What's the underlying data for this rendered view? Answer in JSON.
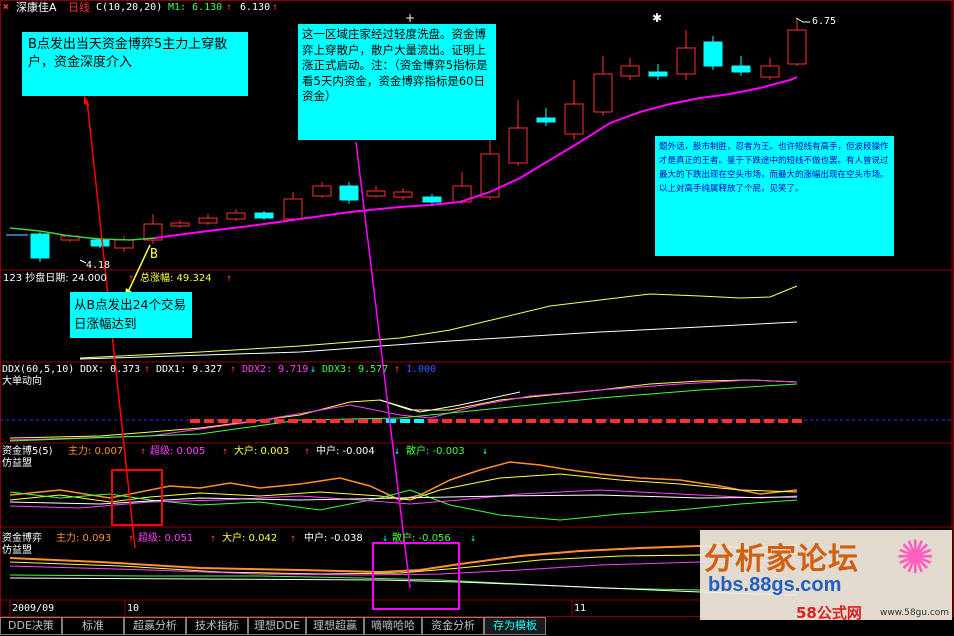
{
  "header": {
    "stock_name": "深康佳A",
    "period": "日线",
    "ma_label": "C(10,20,20)",
    "m1": "M1: 6.130",
    "m1_value": "6.130"
  },
  "price_panel": {
    "high_label": "6.75",
    "low_label": "4.18",
    "point_b": "B"
  },
  "notes": {
    "note1": "B点发出当天资金博弈5主力上穿散户，资金深度介入",
    "note2": "这一区域庄家经过轻度洗盘。资金博弈上穿散户，散户大量流出。证明上涨正式启动。注：（资金博弈5指标是看5天内资金，资金博弈指标是60日资金）",
    "note3": "题外话，股市制胜，忍者为王。也许短线有高手，但波段操作才是真正的王者。鉴于下跌途中的短线不做也罢。有人曾说过最大的下跌出现在空头市场，而最大的涨幅出现在空头市场。以上对高手纯属释放了个屁，见笑了。",
    "note4": "从B点发出24个交易日涨幅达到"
  },
  "indicator1": {
    "title": "123 抄盘日期: 24.000",
    "total_rise": "总涨幅: 49.324"
  },
  "indicator2": {
    "params": "DDX(60,5,10)",
    "ddx": "DDX: 0.373",
    "ddx1": "DDX1: 9.327",
    "ddx2": "DDX2: 9.719",
    "ddx3": "DDX3: 9.577",
    "extra": "1.000",
    "sub": "大单动向"
  },
  "indicator3": {
    "name": "资金博5(5)",
    "main": "主力: 0.007",
    "super": "超级: 0.005",
    "large": "大户: 0.003",
    "mid": "中户: -0.004",
    "retail": "散户: -0.003",
    "sub": "仿益盟"
  },
  "indicator4": {
    "name": "资金博弈",
    "main": "主力: 0.093",
    "super": "超级: 0.051",
    "large": "大户: 0.042",
    "mid": "中户: -0.038",
    "retail": "散户: -0.056",
    "sub": "仿益盟"
  },
  "axis": {
    "d1": "2009/09",
    "d2": "10",
    "d3": "11"
  },
  "tabs": [
    "DDE决策",
    "标准",
    "超赢分析",
    "技术指标",
    "理想DDE",
    "理想超赢",
    "嘀嘀哈哈",
    "资金分析",
    "存为模板"
  ],
  "watermark": {
    "title": "分析家论坛",
    "url": "bbs.88gs.com",
    "brand": "58公式网",
    "brand_url": "www.58gu.com"
  },
  "colors": {
    "up": "#ff3030",
    "down": "#00ffff",
    "ma": "#ff00ff",
    "note_bg": "#00ffff"
  }
}
